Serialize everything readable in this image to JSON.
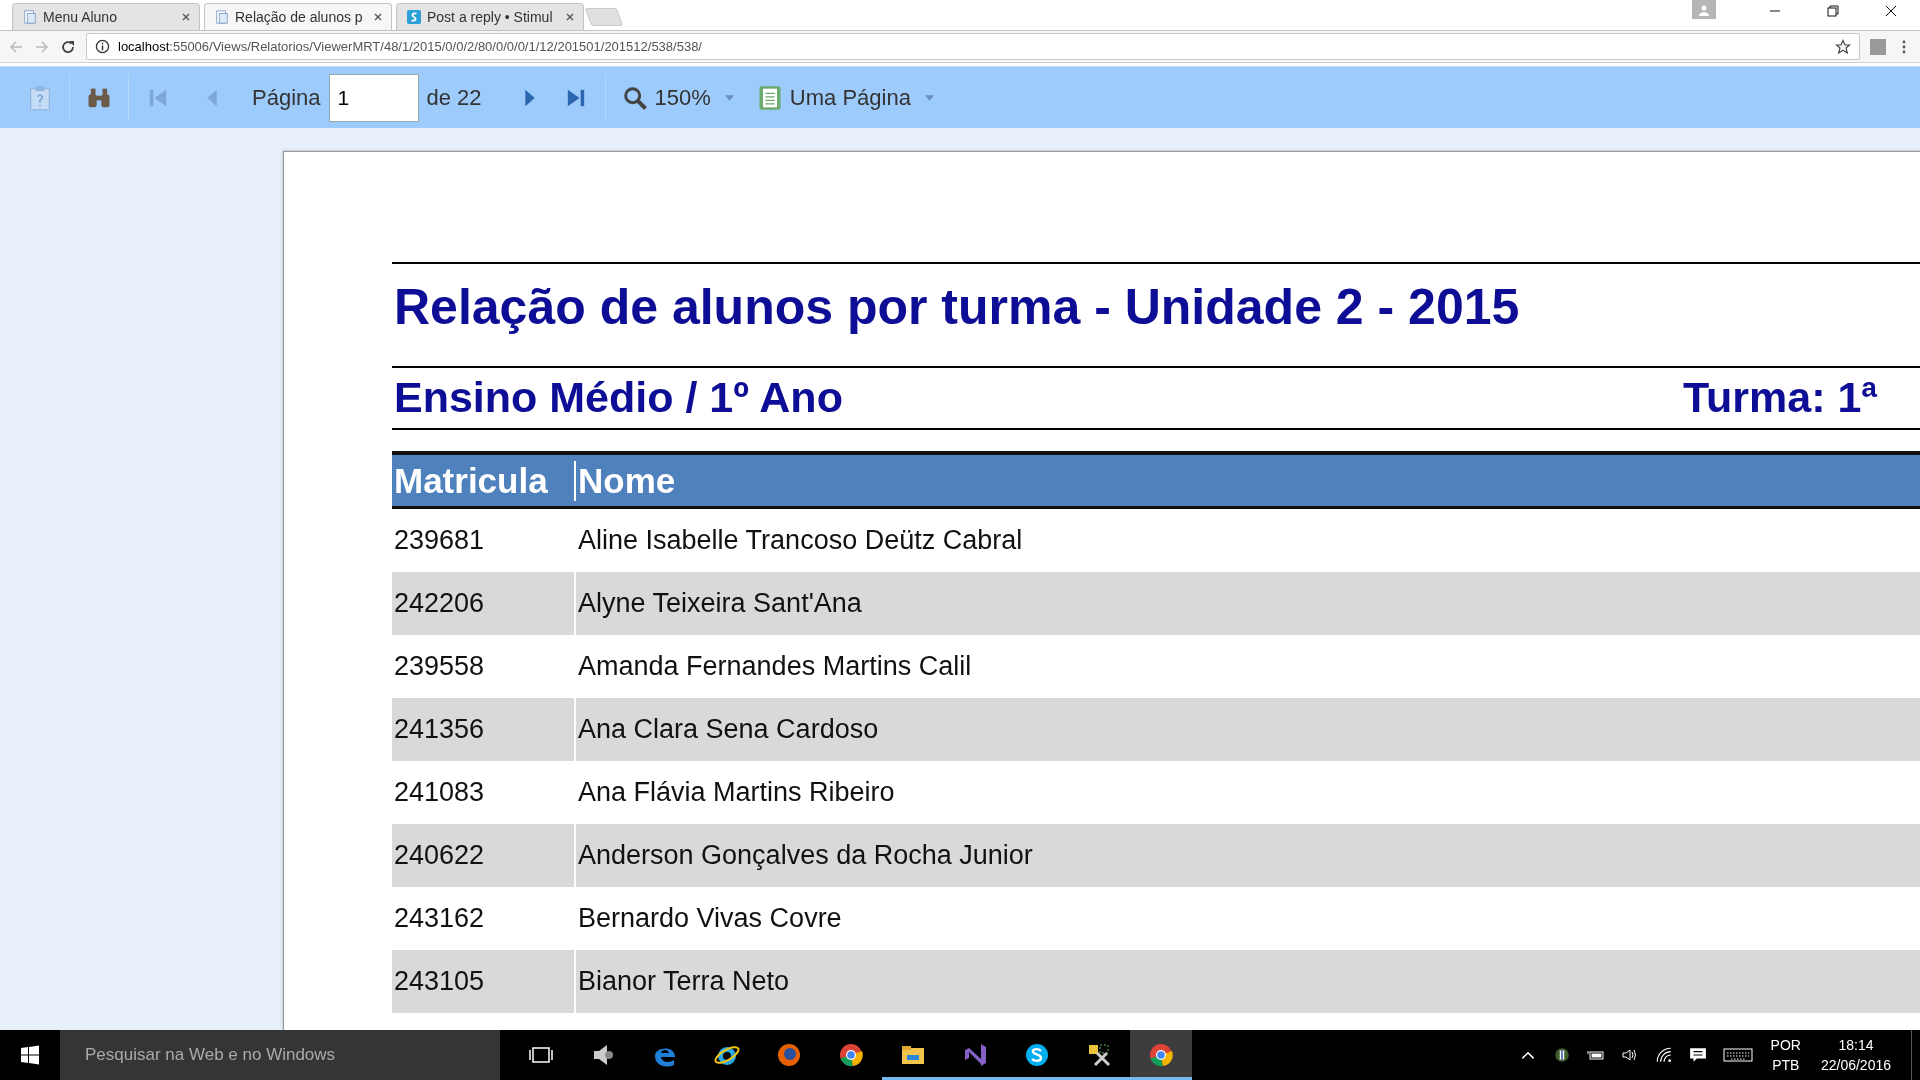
{
  "browser": {
    "tabs": [
      {
        "title": "Menu Aluno",
        "kind": "doc",
        "selected": false
      },
      {
        "title": "Relação de alunos p",
        "kind": "doc",
        "selected": true
      },
      {
        "title": "Post a reply • Stimul",
        "kind": "stimul",
        "selected": false
      }
    ],
    "address": {
      "host": "localhost",
      "path": ":55006/Views/Relatorios/ViewerMRT/48/1/2015/0/0/2/80/0/0/0/1/12/201501/201512/538/538/"
    }
  },
  "toolbar": {
    "page_label": "Página",
    "page_value": "1",
    "page_total": "de 22",
    "zoom": "150%",
    "view_mode": "Uma Página"
  },
  "report": {
    "title": "Relação de alunos por turma - Unidade 2 - 2015",
    "course": "Ensino Médio / 1º Ano",
    "class": "Turma: 1ª",
    "columns": [
      "Matricula",
      "Nome"
    ],
    "rows": [
      [
        "239681",
        "Aline Isabelle Trancoso Deütz Cabral"
      ],
      [
        "242206",
        "Alyne Teixeira Sant'Ana"
      ],
      [
        "239558",
        "Amanda Fernandes Martins Calil"
      ],
      [
        "241356",
        "Ana Clara Sena Cardoso"
      ],
      [
        "241083",
        "Ana Flávia Martins Ribeiro"
      ],
      [
        "240622",
        "Anderson Gonçalves da Rocha Junior"
      ],
      [
        "243162",
        "Bernardo Vivas Covre"
      ],
      [
        "243105",
        "Bianor Terra Neto"
      ]
    ]
  },
  "taskbar": {
    "search": {
      "placeholder": "Pesquisar na Web e no Windows"
    },
    "apps": [
      {
        "kind": "taskview",
        "running": false,
        "selected": false
      },
      {
        "kind": "speaker",
        "running": false,
        "selected": false
      },
      {
        "kind": "edge",
        "running": false,
        "selected": false
      },
      {
        "kind": "ie",
        "running": false,
        "selected": false
      },
      {
        "kind": "firefox",
        "running": false,
        "selected": false
      },
      {
        "kind": "chrome",
        "running": false,
        "selected": false
      },
      {
        "kind": "folder",
        "running": true,
        "selected": false
      },
      {
        "kind": "vs",
        "running": true,
        "selected": false
      },
      {
        "kind": "skype",
        "running": true,
        "selected": false
      },
      {
        "kind": "tools",
        "running": true,
        "selected": false
      },
      {
        "kind": "chrome",
        "running": true,
        "selected": true
      }
    ],
    "language": [
      "POR",
      "PTB"
    ],
    "time": "18:14",
    "date": "22/06/2016"
  }
}
